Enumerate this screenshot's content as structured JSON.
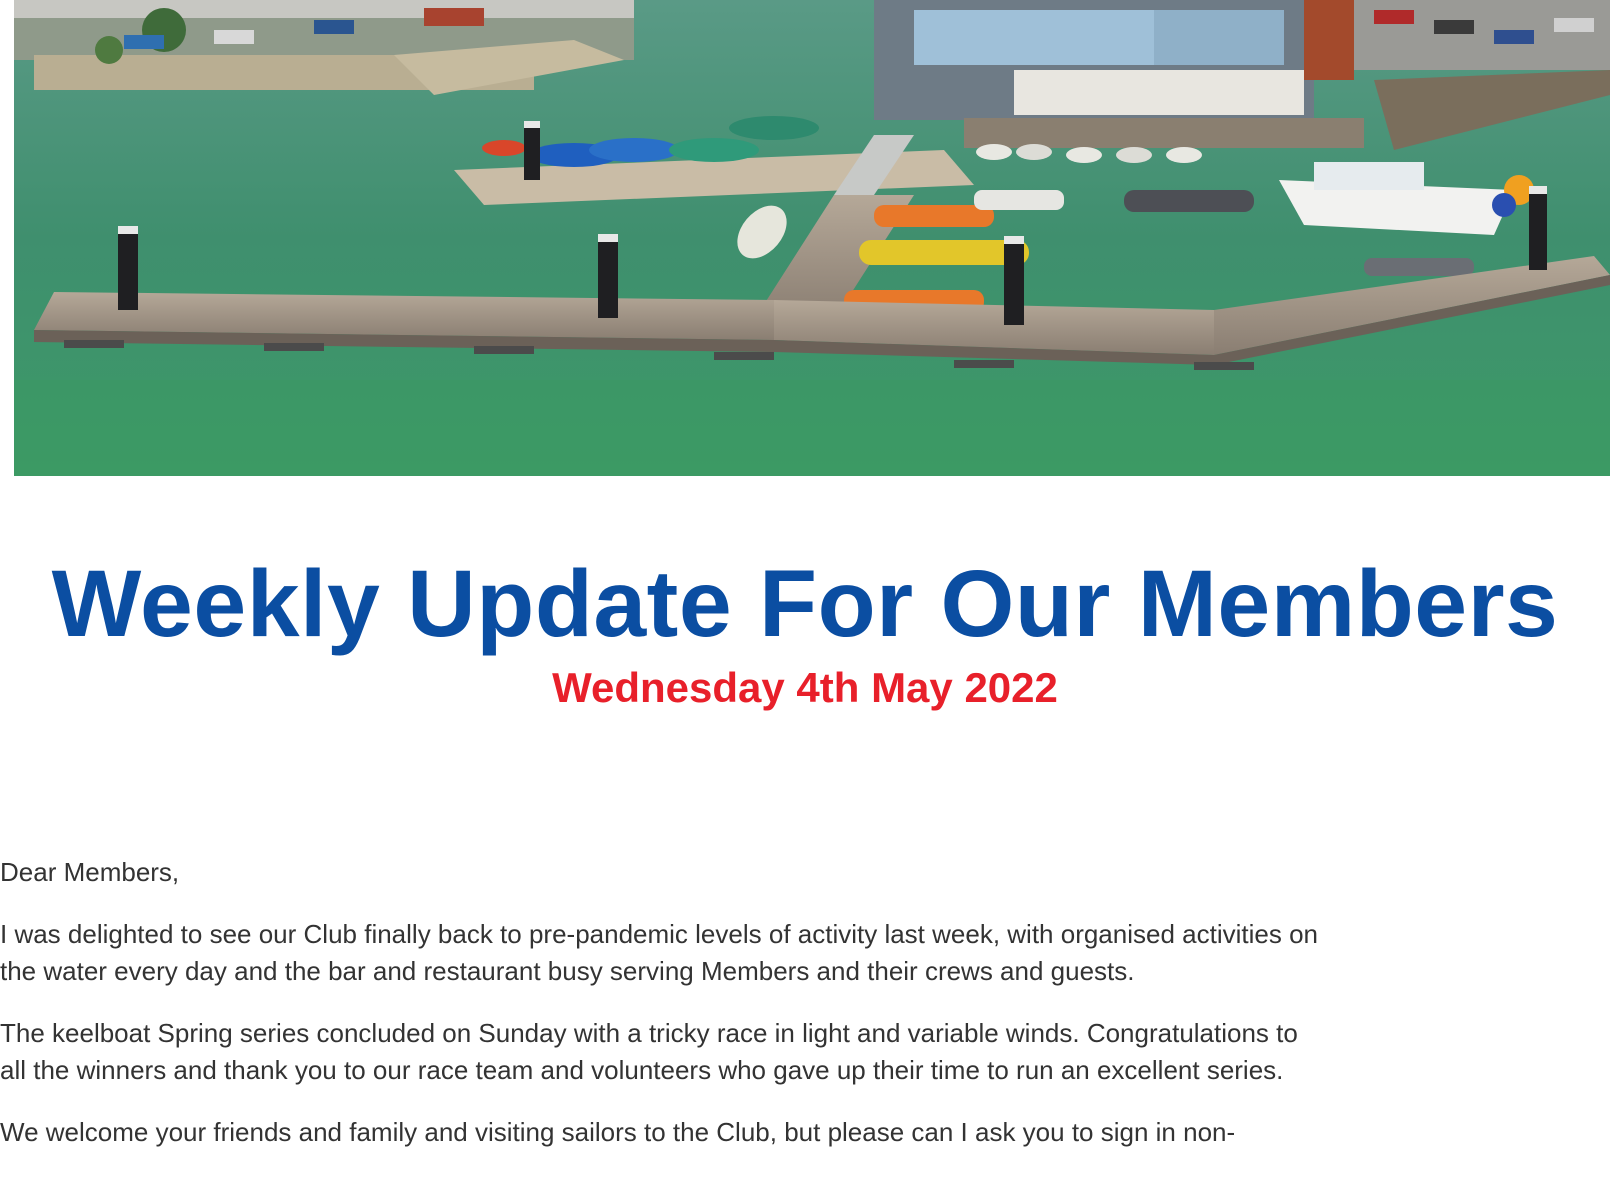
{
  "hero": {
    "image_subject": "harbour-marina-photo"
  },
  "header": {
    "title": "Weekly Update For Our Members",
    "date": "Wednesday 4th May 2022"
  },
  "letter": {
    "salutation": "Dear Members,",
    "p1_line1": "I was delighted to see our Club finally back to pre-pandemic levels of activity last week, with organised activities on",
    "p1_line2": "the water every day and the bar and restaurant busy serving Members and their crews and guests.",
    "p2_line1": "The keelboat Spring series concluded on Sunday with a tricky race in light and variable winds. Congratulations to",
    "p2_line2": "all the winners and thank you to our race team and volunteers who gave up their time to run an excellent series.",
    "p3_line1": "We welcome your friends and family and visiting sailors to the Club, but please can I ask you to sign in non-"
  },
  "colors": {
    "title": "#0b4ea2",
    "date": "#e8202a",
    "body_text": "#333333",
    "water": "#3f8f72"
  }
}
